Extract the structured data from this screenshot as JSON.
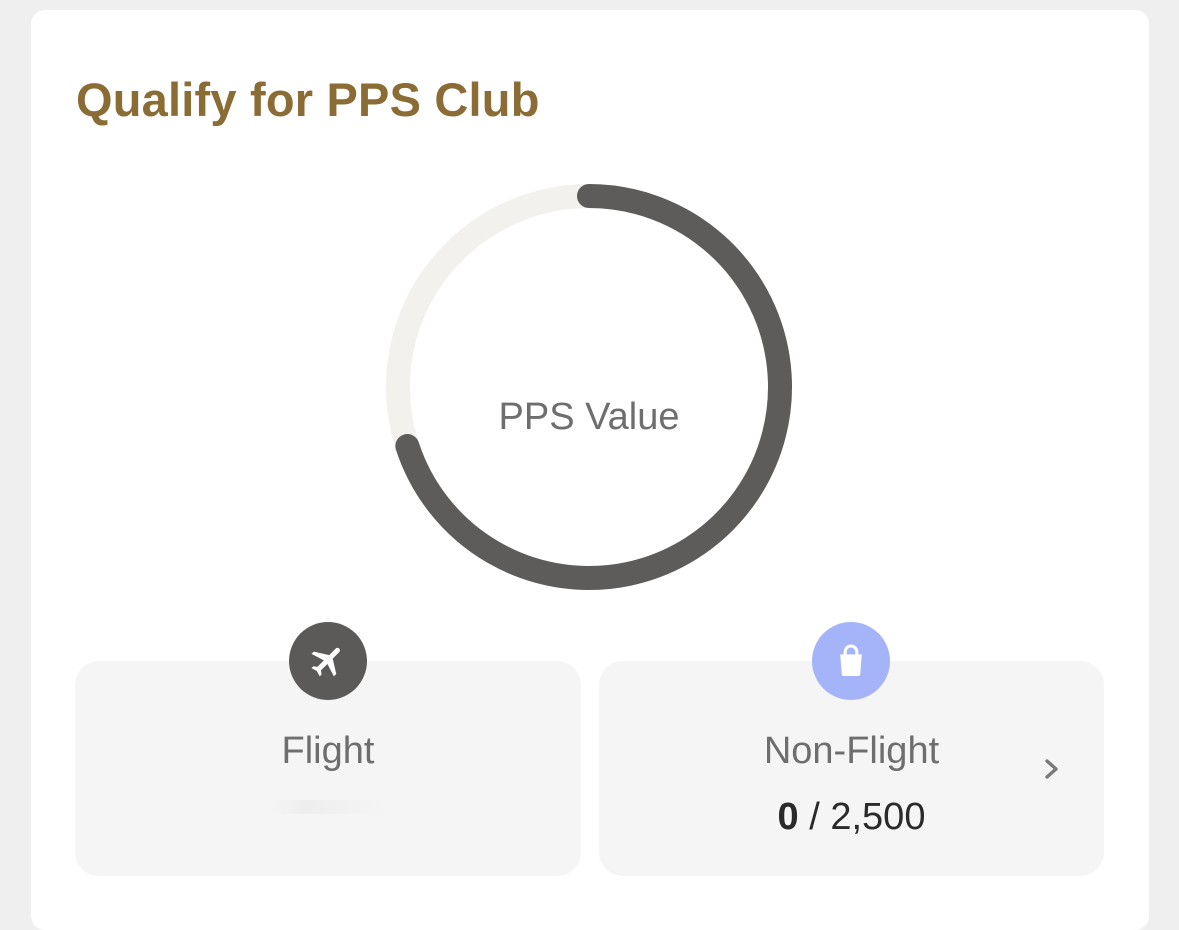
{
  "card": {
    "title": "Qualify for PPS Club"
  },
  "progress_ring": {
    "label": "PPS Value",
    "progress_fraction": 0.7,
    "track_color": "#f3f1ee",
    "fill_color": "#5d5c5a"
  },
  "flight": {
    "label": "Flight",
    "icon": "airplane-icon",
    "icon_bg": "#5b5a58"
  },
  "non_flight": {
    "label": "Non-Flight",
    "current": "0",
    "separator": "/",
    "target": "2,500",
    "icon": "shopping-bag-icon",
    "icon_bg": "#a5b3f8"
  },
  "colors": {
    "title": "#8c6c35",
    "card_bg": "#ffffff",
    "page_bg": "#efefef",
    "box_bg": "#f5f5f5"
  }
}
